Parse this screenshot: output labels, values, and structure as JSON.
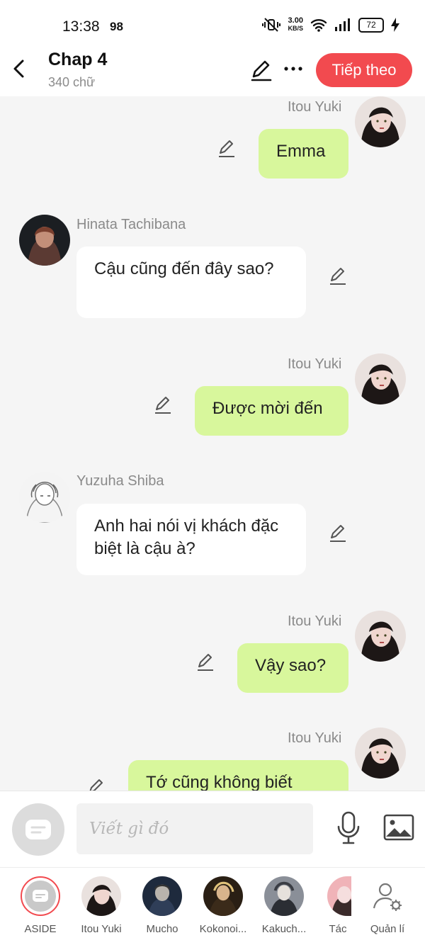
{
  "status_bar": {
    "time": "13:38",
    "badge": "98",
    "speed_value": "3.00",
    "speed_unit": "KB/S",
    "battery": "72"
  },
  "header": {
    "title": "Chap 4",
    "subtitle": "340 chữ",
    "next_button": "Tiếp theo"
  },
  "messages": [
    {
      "speaker": "Itou Yuki",
      "text": "Emma",
      "side": "right"
    },
    {
      "speaker": "Hinata Tachibana",
      "text": "Cậu cũng đến đây sao?",
      "side": "left"
    },
    {
      "speaker": "Itou Yuki",
      "text": "Được mời đến",
      "side": "right"
    },
    {
      "speaker": "Yuzuha Shiba",
      "text": "Anh hai nói vị khách đặc biệt là cậu à?",
      "side": "left"
    },
    {
      "speaker": "Itou Yuki",
      "text": "Vậy sao?",
      "side": "right"
    },
    {
      "speaker": "Itou Yuki",
      "text": "Tớ cũng không biết",
      "side": "right"
    }
  ],
  "composer": {
    "placeholder": "Viết gì đó"
  },
  "bottom_tabs": [
    {
      "label": "ASIDE"
    },
    {
      "label": "Itou Yuki"
    },
    {
      "label": "Mucho"
    },
    {
      "label": "Kokonoi..."
    },
    {
      "label": "Kakuch..."
    },
    {
      "label": "Tác"
    },
    {
      "label": "Quản lí"
    }
  ],
  "colors": {
    "accent": "#f24a4f",
    "outgoing_bubble": "#d8f79c",
    "incoming_bubble": "#ffffff",
    "background": "#f5f5f5"
  }
}
